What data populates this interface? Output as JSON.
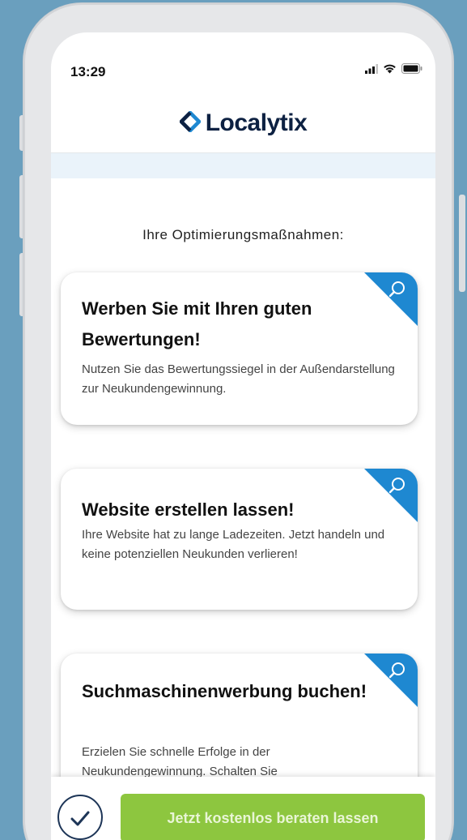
{
  "status": {
    "time": "13:29"
  },
  "header": {
    "logo_text": "Localytix",
    "logo_icon": "diamond-logo-icon",
    "brand_color": "#0d2142",
    "accent_color": "#1e88d1"
  },
  "section_title": "Ihre Optimierungsmaßnahmen:",
  "cards": [
    {
      "title": "Werben Sie mit Ihren guten Bewertungen!",
      "description": "Nutzen Sie das Bewertungssiegel in der Außendarstellung zur Neukundengewinnung.",
      "corner_icon": "search-icon"
    },
    {
      "title": "Website erstellen lassen!",
      "description": "Ihre Website hat zu lange Ladezeiten. Jetzt handeln und keine potenziellen Neukunden verlieren!",
      "corner_icon": "search-icon"
    },
    {
      "title": "Suchmaschinenwerbung buchen!",
      "description": "Erzielen Sie schnelle Erfolge in der Neukundengewinnung. Schalten Sie",
      "corner_icon": "search-icon"
    }
  ],
  "bottom_bar": {
    "cta_label": "Jetzt kostenlos beraten lassen",
    "cta_color": "#8dc63f",
    "left_icon": "check-icon"
  }
}
